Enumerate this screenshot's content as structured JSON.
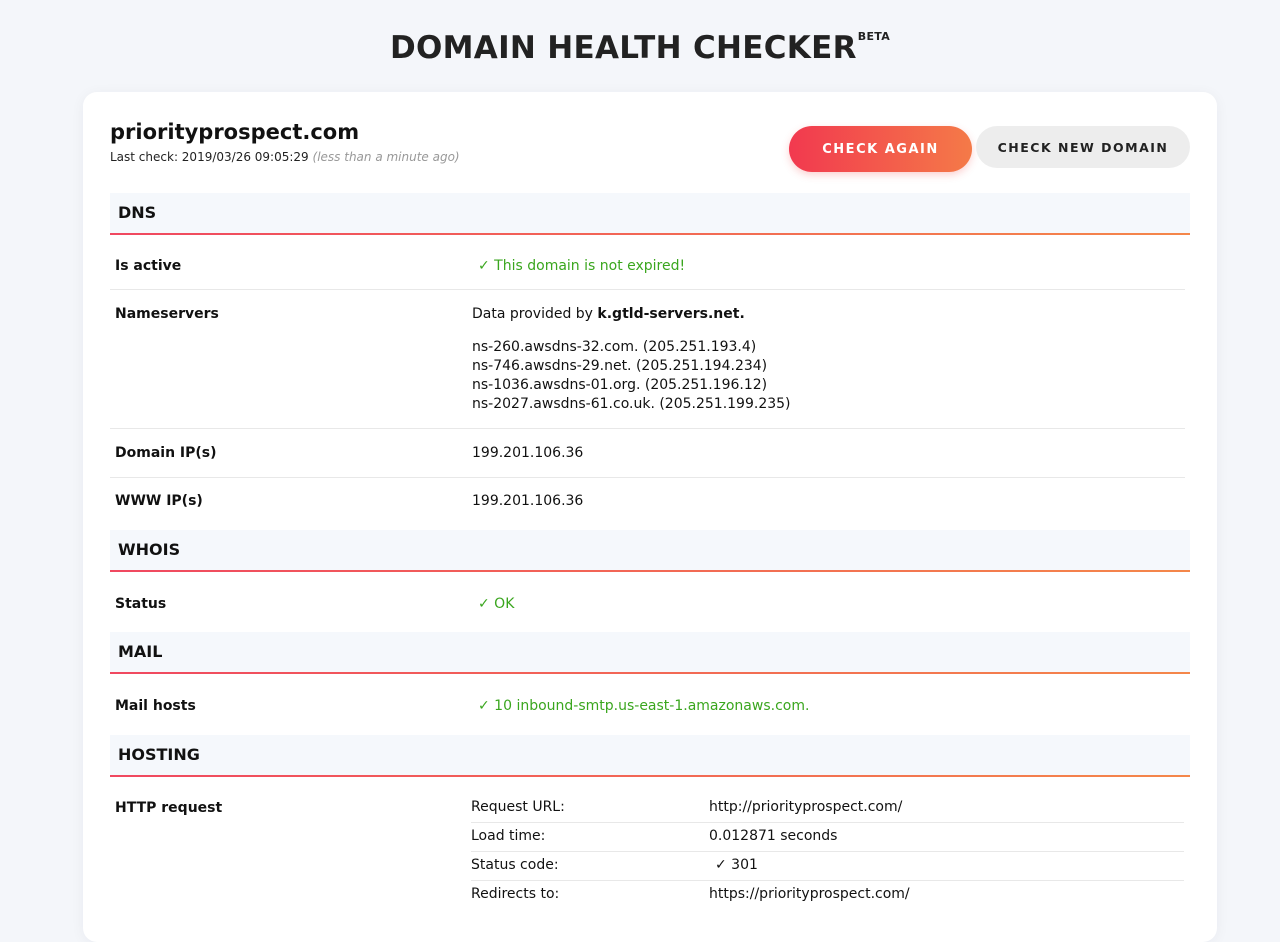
{
  "header": {
    "title": "DOMAIN HEALTH CHECKER",
    "badge": "BETA"
  },
  "domain": {
    "name": "priorityprospect.com",
    "last_check_label": "Last check: 2019/03/26 09:05:29",
    "last_check_relative": "(less than a minute ago)"
  },
  "buttons": {
    "check_again": "CHECK AGAIN",
    "check_new": "CHECK NEW DOMAIN"
  },
  "sections": {
    "dns": {
      "title": "DNS",
      "is_active_label": "Is active",
      "is_active_value": "✓ This domain is not expired!",
      "nameservers_label": "Nameservers",
      "nameservers_provider_prefix": "Data provided by ",
      "nameservers_provider": "k.gtld-servers.net.",
      "nameservers": [
        "ns-260.awsdns-32.com. (205.251.193.4)",
        "ns-746.awsdns-29.net. (205.251.194.234)",
        "ns-1036.awsdns-01.org. (205.251.196.12)",
        "ns-2027.awsdns-61.co.uk. (205.251.199.235)"
      ],
      "domain_ips_label": "Domain IP(s)",
      "domain_ips_value": "199.201.106.36",
      "www_ips_label": "WWW IP(s)",
      "www_ips_value": "199.201.106.36"
    },
    "whois": {
      "title": "WHOIS",
      "status_label": "Status",
      "status_value": "✓ OK"
    },
    "mail": {
      "title": "MAIL",
      "mail_hosts_label": "Mail hosts",
      "mail_hosts_value": "✓ 10 inbound-smtp.us-east-1.amazonaws.com."
    },
    "hosting": {
      "title": "HOSTING",
      "http_request_label": "HTTP request",
      "http": [
        {
          "key": "Request URL:",
          "value": "http://priorityprospect.com/"
        },
        {
          "key": "Load time:",
          "value": "0.012871 seconds"
        },
        {
          "key": "Status code:",
          "value": "✓ 301"
        },
        {
          "key": "Redirects to:",
          "value": "https://priorityprospect.com/"
        }
      ]
    }
  },
  "colors": {
    "ok_green": "#3aa61e",
    "accent_start": "#f2394f",
    "accent_end": "#f47a48"
  }
}
